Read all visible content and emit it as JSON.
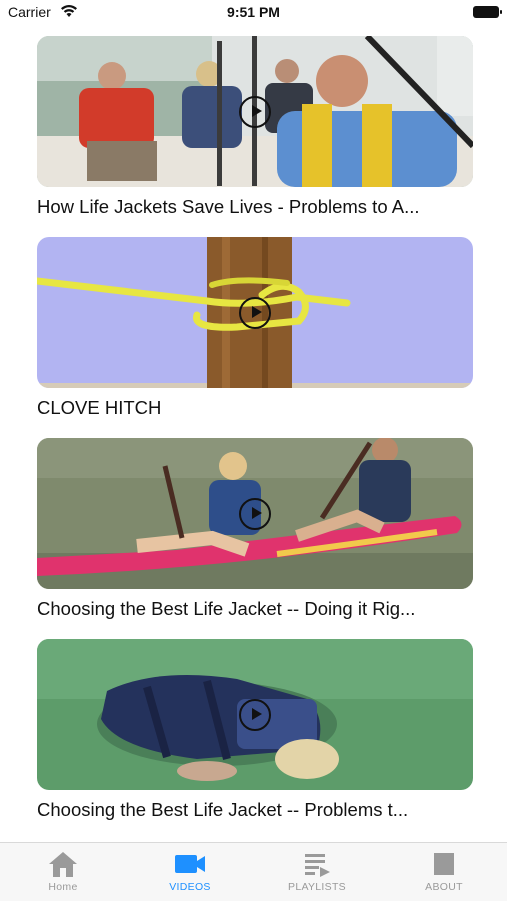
{
  "status_bar": {
    "carrier": "Carrier",
    "time": "9:51 PM"
  },
  "videos": [
    {
      "title": "How Life Jackets Save Lives - Problems to A..."
    },
    {
      "title": "CLOVE HITCH"
    },
    {
      "title": "Choosing the Best Life Jacket -- Doing it Rig..."
    },
    {
      "title": "Choosing the Best Life Jacket -- Problems t..."
    }
  ],
  "tabs": [
    {
      "label": "Home",
      "icon": "home-icon"
    },
    {
      "label": "VIDEOS",
      "icon": "video-camera-icon",
      "active": true
    },
    {
      "label": "PLAYLISTS",
      "icon": "playlist-icon"
    },
    {
      "label": "ABOUT",
      "icon": "about-icon"
    }
  ],
  "colors": {
    "accent": "#1e90ff",
    "inactive": "#9a9a9a"
  }
}
